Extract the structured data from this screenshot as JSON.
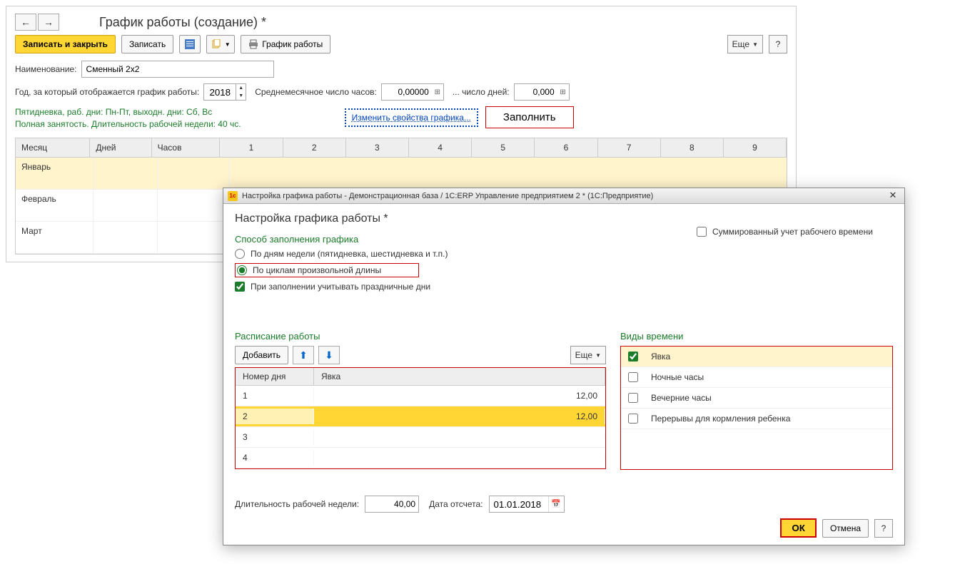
{
  "main": {
    "title": "График работы (создание) *",
    "nav": {
      "back": "←",
      "forward": "→"
    },
    "toolbar": {
      "save_close": "Записать и закрыть",
      "save": "Записать",
      "print_schedule": "График работы",
      "more": "Еще",
      "help": "?"
    },
    "fields": {
      "name_label": "Наименование:",
      "name_value": "Сменный 2х2",
      "year_label": "Год, за который отображается график работы:",
      "year_value": "2018",
      "avg_hours_label": "Среднемесячное число часов:",
      "avg_hours_value": "0,00000",
      "avg_days_label": "... число дней:",
      "avg_days_value": "0,000"
    },
    "info": {
      "line1": "Пятидневка, раб. дни: Пн-Пт, выходн. дни: Сб, Вс",
      "line2": "Полная занятость. Длительность рабочей недели: 40 чс.",
      "edit_link": "Изменить свойства графика...",
      "fill": "Заполнить"
    },
    "grid": {
      "headers": {
        "month": "Месяц",
        "days": "Дней",
        "hours": "Часов"
      },
      "day_cols": [
        "1",
        "2",
        "3",
        "4",
        "5",
        "6",
        "7",
        "8",
        "9"
      ],
      "rows": [
        {
          "month": "Январь"
        },
        {
          "month": "Февраль"
        },
        {
          "month": "Март"
        }
      ]
    }
  },
  "dialog": {
    "title_bar": "Настройка графика работы - Демонстрационная база / 1С:ERP Управление предприятием 2 *  (1С:Предприятие)",
    "title": "Настройка графика работы *",
    "fill_method": {
      "section": "Способ заполнения графика",
      "by_weekdays": "По дням недели (пятидневка, шестидневка и т.п.)",
      "by_cycle": "По циклам произвольной длины",
      "consider_holidays": "При заполнении учитывать праздничные дни",
      "summed_time": "Суммированный учет рабочего времени"
    },
    "schedule": {
      "section": "Расписание работы",
      "add": "Добавить",
      "more": "Еще",
      "headers": {
        "day": "Номер дня",
        "attend": "Явка"
      },
      "rows": [
        {
          "day": "1",
          "hours": "12,00"
        },
        {
          "day": "2",
          "hours": "12,00"
        },
        {
          "day": "3",
          "hours": ""
        },
        {
          "day": "4",
          "hours": ""
        }
      ]
    },
    "time_types": {
      "section": "Виды времени",
      "items": [
        {
          "label": "Явка",
          "checked": true
        },
        {
          "label": "Ночные часы",
          "checked": false
        },
        {
          "label": "Вечерние часы",
          "checked": false
        },
        {
          "label": "Перерывы для кормления ребенка",
          "checked": false
        }
      ]
    },
    "bottom": {
      "week_len_label": "Длительность рабочей недели:",
      "week_len_value": "40,00",
      "start_date_label": "Дата отсчета:",
      "start_date_value": "01.01.2018"
    },
    "footer": {
      "ok": "ОК",
      "cancel": "Отмена",
      "help": "?"
    }
  }
}
